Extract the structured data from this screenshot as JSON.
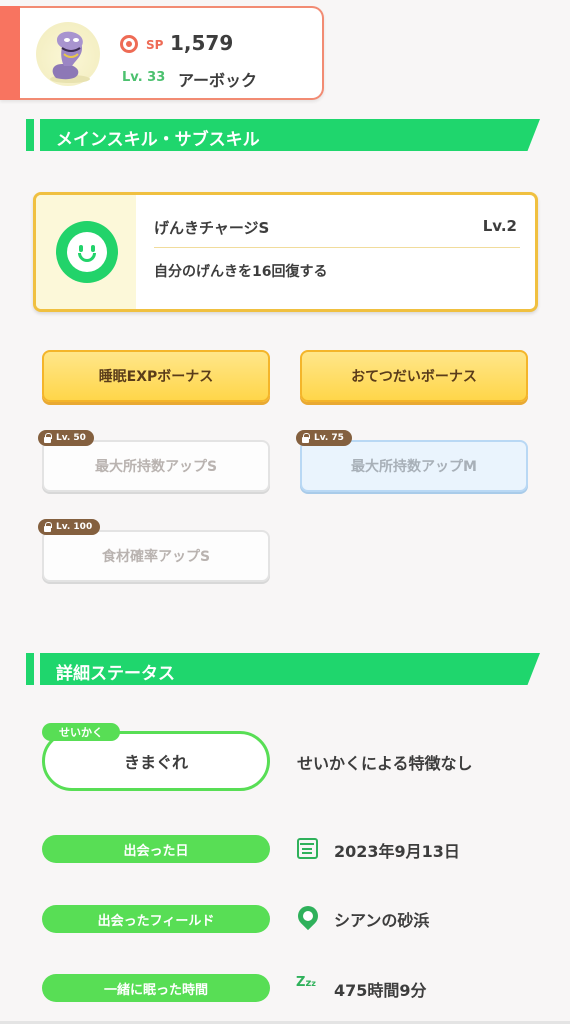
{
  "pokemon": {
    "sp_label": "SP",
    "sp_value": "1,579",
    "level_label": "Lv. 33",
    "name": "アーボック"
  },
  "skills_section": {
    "title": "メインスキル・サブスキル"
  },
  "main_skill": {
    "name": "げんきチャージS",
    "level": "Lv.2",
    "description": "自分のげんきを16回復する",
    "icon": "smiley-face-icon"
  },
  "sub_skills": [
    {
      "label": "睡眠EXPボーナス",
      "unlocked": true
    },
    {
      "label": "おてつだいボーナス",
      "unlocked": true
    },
    {
      "label": "最大所持数アップS",
      "unlocked": false,
      "lock_level": "Lv. 50"
    },
    {
      "label": "最大所持数アップM",
      "unlocked": false,
      "lock_level": "Lv. 75"
    },
    {
      "label": "食材確率アップS",
      "unlocked": false,
      "lock_level": "Lv. 100"
    }
  ],
  "details_section": {
    "title": "詳細ステータス"
  },
  "nature": {
    "tag": "せいかく",
    "value": "きまぐれ",
    "description": "せいかくによる特徴なし"
  },
  "details": [
    {
      "label": "出会った日",
      "value": "2023年9月13日",
      "icon": "calendar-icon"
    },
    {
      "label": "出会ったフィールド",
      "value": "シアンの砂浜",
      "icon": "location-pin-icon"
    },
    {
      "label": "一緒に眠った時間",
      "value": "475時間9分",
      "icon": "zzz-sleep-icon"
    }
  ],
  "colors": {
    "accent_green": "#1fd66d",
    "pill_green": "#58de55",
    "skill_border_gold": "#f0c040",
    "card_border_coral": "#f28b73"
  }
}
